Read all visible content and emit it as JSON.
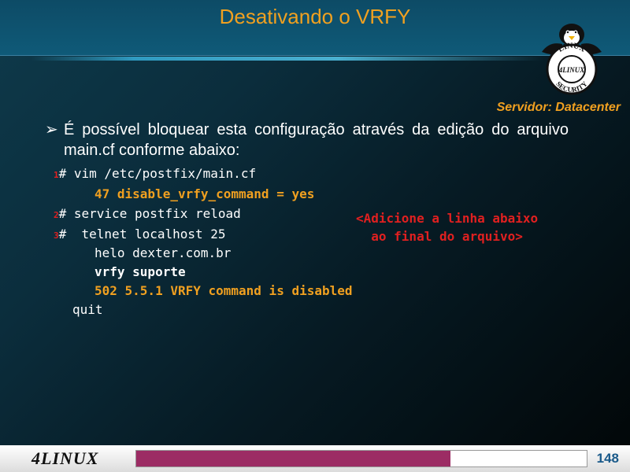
{
  "slide": {
    "title": "Desativando o VRFY",
    "server_label": "Servidor: Datacenter",
    "bullet_text": "É possível bloquear esta configuração através da edição do arquivo main.cf conforme abaixo:",
    "bullet_icon": "arrow-bullet-icon",
    "note_line1": "<Adicione a linha abaixo",
    "note_line2": "ao final do arquivo>"
  },
  "terminal": {
    "step1": {
      "num": "1",
      "text": "# vim /etc/postfix/main.cf"
    },
    "config_line": "47 disable_vrfy_command = yes",
    "step2": {
      "num": "2",
      "text": "# service postfix reload"
    },
    "step3": {
      "num": "3",
      "text": "#  telnet localhost 25"
    },
    "helo": "helo dexter.com.br",
    "vrfy": "vrfy suporte",
    "response": "502 5.5.1 VRFY command is disabled",
    "quit": "quit"
  },
  "logo": {
    "top_text": "LINUX",
    "center_text": "4LINUX",
    "bottom_text": "SECURITY"
  },
  "footer": {
    "brand": "4LINUX",
    "page_number": "148",
    "progress_fraction": 0.697
  },
  "colors": {
    "title": "#f0a020",
    "accent_red": "#e02020",
    "progress": "#9c2c64",
    "page_number": "#1a5a8a"
  }
}
